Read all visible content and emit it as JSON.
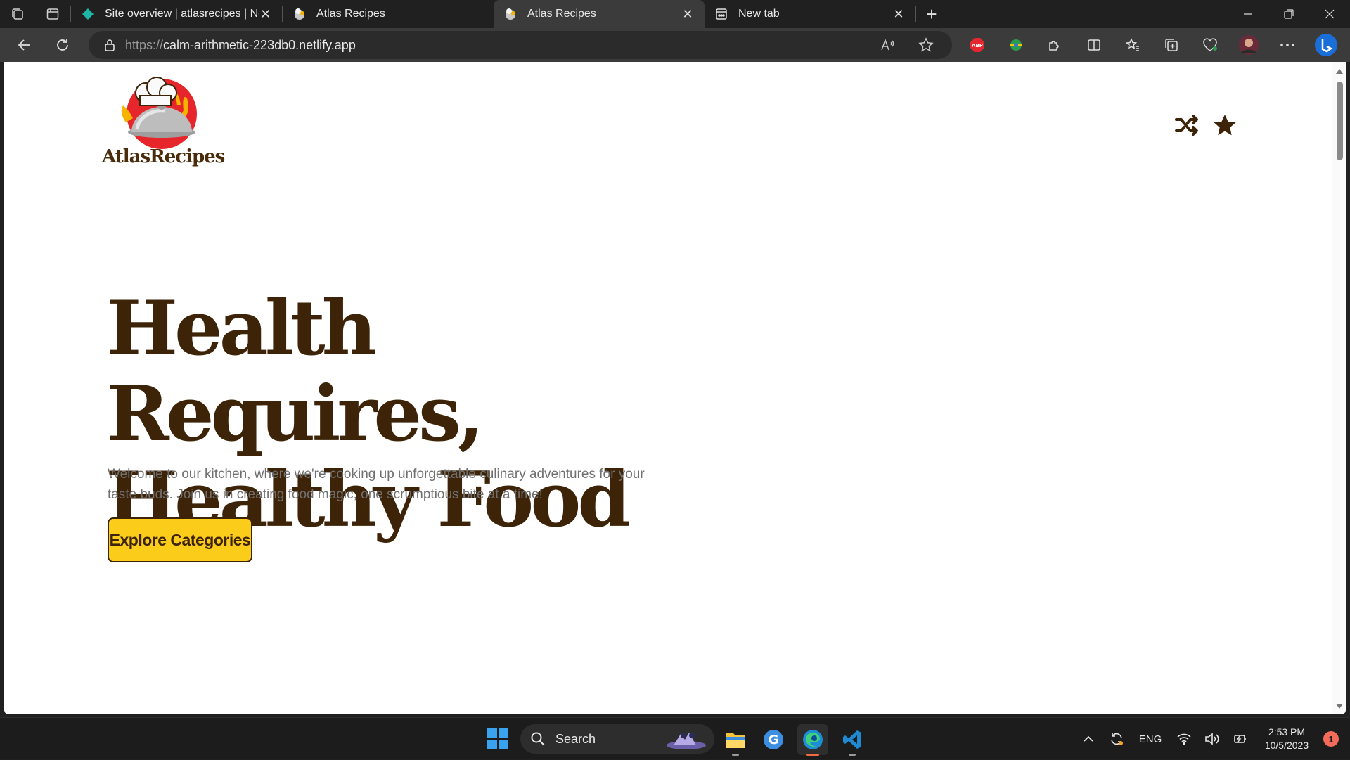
{
  "browser": {
    "tabs": [
      {
        "title": "Site overview | atlasrecipes | Netl",
        "favicon": "netlify-icon",
        "active": false
      },
      {
        "title": "Atlas Recipes",
        "favicon": "atlas-recipes-icon",
        "active": false
      },
      {
        "title": "Atlas Recipes",
        "favicon": "atlas-recipes-icon",
        "active": true
      },
      {
        "title": "New tab",
        "favicon": "new-tab-icon",
        "active": false
      }
    ],
    "url_scheme": "https://",
    "url_host": "calm-arithmetic-223db0.netlify.app"
  },
  "page": {
    "logo_text": "AtlasRecipes",
    "hero_line1": "Health Requires,",
    "hero_line2": "Healthy Food",
    "subtitle": "Welcome to our kitchen, where we're cooking up unforgettable culinary adventures for your taste buds. Join us in creating food magic, one scrumptious bite at a time!",
    "cta_label": "Explore Categories"
  },
  "taskbar": {
    "search_placeholder": "Search",
    "language": "ENG",
    "time": "2:53 PM",
    "date": "10/5/2023",
    "notification_count": "1"
  },
  "colors": {
    "brand_brown": "#3d2408",
    "cta_yellow": "#fccc1b",
    "edge_active_indicator": "#f06a3e"
  }
}
